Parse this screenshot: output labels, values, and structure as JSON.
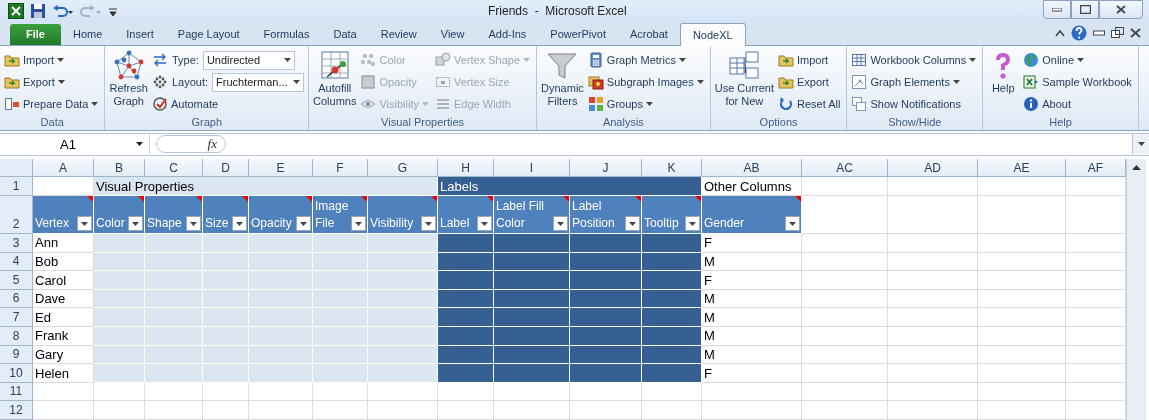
{
  "window": {
    "title": "Friends  -  Microsoft Excel"
  },
  "tabs": [
    {
      "label": "File",
      "selected": false,
      "kind": "file"
    },
    {
      "label": "Home",
      "selected": false,
      "kind": "tab"
    },
    {
      "label": "Insert",
      "selected": false,
      "kind": "tab"
    },
    {
      "label": "Page Layout",
      "selected": false,
      "kind": "tab"
    },
    {
      "label": "Formulas",
      "selected": false,
      "kind": "tab"
    },
    {
      "label": "Data",
      "selected": false,
      "kind": "tab"
    },
    {
      "label": "Review",
      "selected": false,
      "kind": "tab"
    },
    {
      "label": "View",
      "selected": false,
      "kind": "tab"
    },
    {
      "label": "Add-Ins",
      "selected": false,
      "kind": "tab"
    },
    {
      "label": "PowerPivot",
      "selected": false,
      "kind": "tab"
    },
    {
      "label": "Acrobat",
      "selected": false,
      "kind": "tab"
    },
    {
      "label": "NodeXL",
      "selected": true,
      "kind": "tab"
    }
  ],
  "ribbon": {
    "groups": [
      {
        "label": "Data",
        "columns": [
          {
            "kind": "stack",
            "items": [
              {
                "kind": "small",
                "label": "Import",
                "dropdown": true,
                "disabled": false
              },
              {
                "kind": "small",
                "label": "Export",
                "dropdown": true,
                "disabled": false
              },
              {
                "kind": "small",
                "label": "Prepare Data",
                "dropdown": true,
                "disabled": false
              }
            ]
          }
        ]
      },
      {
        "label": "Graph",
        "columns": [
          {
            "kind": "large",
            "label": "Refresh\nGraph"
          },
          {
            "kind": "stack",
            "items": [
              {
                "kind": "combo",
                "label": "Type:",
                "value": "Undirected"
              },
              {
                "kind": "combo",
                "label": "Layout:",
                "value": "Fruchterman..."
              },
              {
                "kind": "small",
                "label": "Automate",
                "dropdown": false,
                "disabled": false
              }
            ]
          }
        ]
      },
      {
        "label": "Visual Properties",
        "columns": [
          {
            "kind": "large",
            "label": "Autofill\nColumns"
          },
          {
            "kind": "stack",
            "items": [
              {
                "kind": "small",
                "label": "Color",
                "dropdown": false,
                "disabled": true
              },
              {
                "kind": "small",
                "label": "Opacity",
                "dropdown": false,
                "disabled": true
              },
              {
                "kind": "small",
                "label": "Visibility",
                "dropdown": true,
                "disabled": true
              }
            ]
          },
          {
            "kind": "stack",
            "items": [
              {
                "kind": "small",
                "label": "Vertex Shape",
                "dropdown": true,
                "disabled": true
              },
              {
                "kind": "small",
                "label": "Vertex Size",
                "dropdown": false,
                "disabled": true
              },
              {
                "kind": "small",
                "label": "Edge Width",
                "dropdown": false,
                "disabled": true
              }
            ]
          }
        ]
      },
      {
        "label": "Analysis",
        "columns": [
          {
            "kind": "large",
            "label": "Dynamic\nFilters"
          },
          {
            "kind": "stack",
            "items": [
              {
                "kind": "small",
                "label": "Graph Metrics",
                "dropdown": true,
                "disabled": false
              },
              {
                "kind": "small",
                "label": "Subgraph Images",
                "dropdown": true,
                "disabled": false
              },
              {
                "kind": "small",
                "label": "Groups",
                "dropdown": true,
                "disabled": false
              }
            ]
          }
        ]
      },
      {
        "label": "Options",
        "columns": [
          {
            "kind": "large",
            "label": "Use Current\nfor New"
          },
          {
            "kind": "stack",
            "items": [
              {
                "kind": "small",
                "label": "Import",
                "dropdown": false,
                "disabled": false
              },
              {
                "kind": "small",
                "label": "Export",
                "dropdown": false,
                "disabled": false
              },
              {
                "kind": "small",
                "label": "Reset All",
                "dropdown": false,
                "disabled": false
              }
            ]
          }
        ]
      },
      {
        "label": "Show/Hide",
        "columns": [
          {
            "kind": "stack",
            "items": [
              {
                "kind": "small",
                "label": "Workbook Columns",
                "dropdown": true,
                "disabled": false
              },
              {
                "kind": "small",
                "label": "Graph Elements",
                "dropdown": true,
                "disabled": false
              },
              {
                "kind": "small",
                "label": "Show Notifications",
                "dropdown": false,
                "disabled": false
              }
            ]
          }
        ]
      },
      {
        "label": "Help",
        "columns": [
          {
            "kind": "large",
            "label": "Help"
          },
          {
            "kind": "stack",
            "items": [
              {
                "kind": "small",
                "label": "Online",
                "dropdown": true,
                "disabled": false
              },
              {
                "kind": "small",
                "label": "Sample Workbook",
                "dropdown": false,
                "disabled": false
              },
              {
                "kind": "small",
                "label": "About",
                "dropdown": false,
                "disabled": false
              }
            ]
          }
        ]
      }
    ]
  },
  "formula_bar": {
    "name_box": "A1",
    "function_label": "fx"
  },
  "sheet": {
    "column_letters": [
      "A",
      "B",
      "C",
      "D",
      "E",
      "F",
      "G",
      "H",
      "I",
      "J",
      "K",
      "AB",
      "AC",
      "AD",
      "AE",
      "AF"
    ],
    "row_numbers": [
      "1",
      "2",
      "3",
      "4",
      "5",
      "6",
      "7",
      "8",
      "9",
      "10",
      "11",
      "12"
    ],
    "sections": [
      {
        "kind": "vertex",
        "headers": [
          "Vertex"
        ]
      },
      {
        "kind": "visual",
        "title": "Visual Properties",
        "headers": [
          "Color",
          "Shape",
          "Size",
          "Opacity",
          "Image File",
          "Visibility"
        ]
      },
      {
        "kind": "labels",
        "title": "Labels",
        "headers": [
          "Label",
          "Label Fill Color",
          "Label Position",
          "Tooltip"
        ]
      },
      {
        "kind": "other",
        "title": "Other Columns",
        "headers": [
          "Gender"
        ]
      }
    ],
    "rows": [
      {
        "vertex": "Ann",
        "gender": "F"
      },
      {
        "vertex": "Bob",
        "gender": "M"
      },
      {
        "vertex": "Carol",
        "gender": "F"
      },
      {
        "vertex": "Dave",
        "gender": "M"
      },
      {
        "vertex": "Ed",
        "gender": "M"
      },
      {
        "vertex": "Frank",
        "gender": "M"
      },
      {
        "vertex": "Gary",
        "gender": "M"
      },
      {
        "vertex": "Helen",
        "gender": "F"
      }
    ]
  }
}
